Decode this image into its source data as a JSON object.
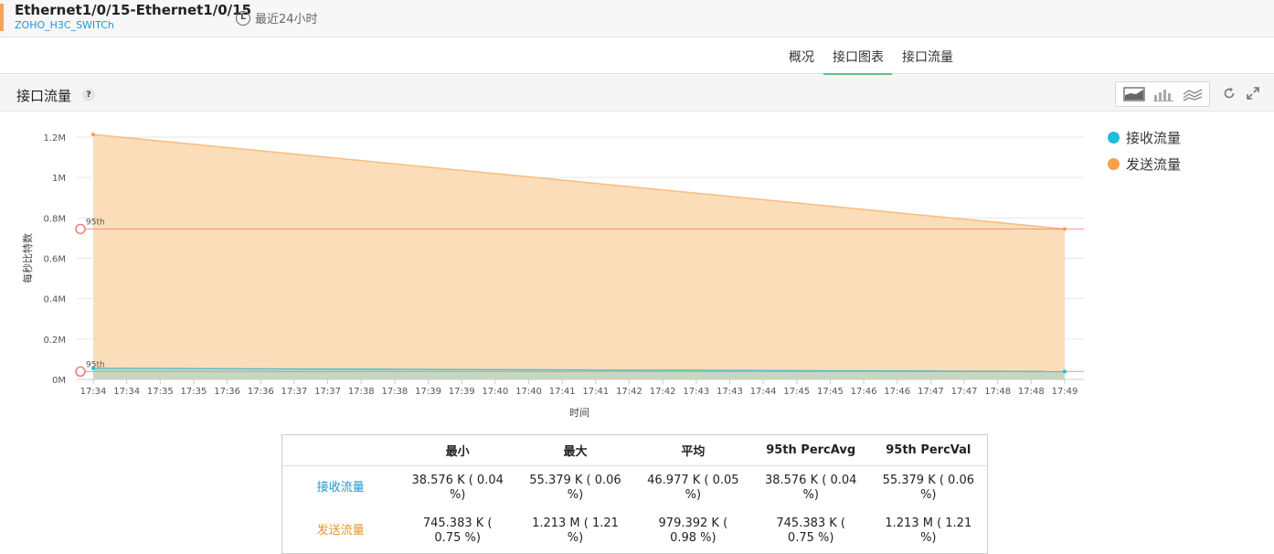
{
  "header": {
    "title": "Ethernet1/0/15-Ethernet1/0/15",
    "subtitle": "ZOHO_H3C_SWITCh",
    "period": "最近24小时",
    "clock_glyph": "L"
  },
  "tabs": [
    {
      "label": "概况",
      "active": false
    },
    {
      "label": "接口图表",
      "active": true
    },
    {
      "label": "接口流量",
      "active": false
    }
  ],
  "panel": {
    "title": "接口流量",
    "help_glyph": "?",
    "chart_type_icons": [
      "area-chart-icon",
      "bar-chart-icon",
      "line-chart-icon"
    ]
  },
  "colors": {
    "receive": "#1bbfd6",
    "send": "#f5a04a",
    "percentile_line": "#f08080",
    "accent": "#5cc57b"
  },
  "chart_data": {
    "type": "area",
    "xlabel": "时间",
    "ylabel": "每秒比特数",
    "ylim": [
      0,
      1.2
    ],
    "y_unit_suffix": "M",
    "yticks": [
      "0M",
      "0.2M",
      "0.4M",
      "0.6M",
      "0.8M",
      "1M",
      "1.2M"
    ],
    "yticks_values": [
      0,
      0.2,
      0.4,
      0.6,
      0.8,
      1.0,
      1.2
    ],
    "x_tick_labels": [
      "17:34",
      "17:34",
      "17:35",
      "17:35",
      "17:36",
      "17:36",
      "17:37",
      "17:37",
      "17:38",
      "17:38",
      "17:39",
      "17:39",
      "17:40",
      "17:40",
      "17:41",
      "17:41",
      "17:42",
      "17:42",
      "17:43",
      "17:43",
      "17:44",
      "17:45",
      "17:45",
      "17:46",
      "17:46",
      "17:47",
      "17:47",
      "17:48",
      "17:48",
      "17:49"
    ],
    "x": [
      "17:34",
      "17:49"
    ],
    "series": [
      {
        "name": "接收流量",
        "values": [
          0.055,
          0.039
        ]
      },
      {
        "name": "发送流量",
        "values": [
          1.213,
          0.745
        ]
      }
    ],
    "percentile_markers": [
      {
        "label": "95th",
        "value": 0.745
      },
      {
        "label": "95th",
        "value": 0.039
      }
    ],
    "legend_position": "top-right",
    "grid": true
  },
  "stats": {
    "headers": [
      "",
      "最小",
      "最大",
      "平均",
      "95th PercAvg",
      "95th PercVal"
    ],
    "rows": [
      {
        "label": "接收流量",
        "color": "#1a9ad6",
        "cells": [
          "38.576 K ( 0.04 %)",
          "55.379 K ( 0.06 %)",
          "46.977 K ( 0.05 %)",
          "38.576 K ( 0.04 %)",
          "55.379 K ( 0.06 %)"
        ]
      },
      {
        "label": "发送流量",
        "color": "#e8962e",
        "cells": [
          "745.383 K ( 0.75 %)",
          "1.213 M ( 1.21 %)",
          "979.392 K ( 0.98 %)",
          "745.383 K ( 0.75 %)",
          "1.213 M ( 1.21 %)"
        ]
      }
    ]
  }
}
